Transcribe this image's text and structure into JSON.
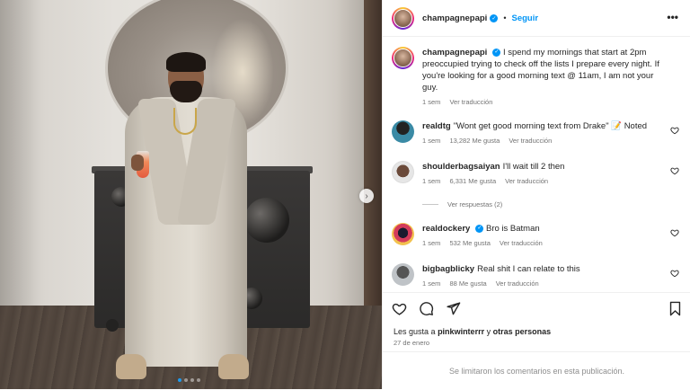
{
  "media": {
    "carousel_dots": 4,
    "active_dot": 0
  },
  "header": {
    "username": "champagnepapi",
    "separator": "•",
    "follow_label": "Seguir",
    "more_label": "•••"
  },
  "caption": {
    "username": "champagnepapi",
    "text": "I spend my mornings that start at 2pm preoccupied trying to check off the lists I prepare every night. If you're looking for a good morning text @ 11am, I am not your guy.",
    "time": "1 sem",
    "translate": "Ver traducción"
  },
  "comments": [
    {
      "username": "realdtg",
      "verified": false,
      "text": "\"Wont get good morning text from Drake\" 📝 Noted",
      "time": "1 sem",
      "likes": "13,282 Me gusta",
      "translate": "Ver traducción"
    },
    {
      "username": "shoulderbagsaiyan",
      "verified": false,
      "text": "I'll wait till 2 then",
      "time": "1 sem",
      "likes": "6,331 Me gusta",
      "translate": "Ver traducción"
    },
    {
      "username": "realdockery",
      "verified": true,
      "text": "Bro is Batman",
      "time": "1 sem",
      "likes": "532 Me gusta",
      "translate": "Ver traducción"
    },
    {
      "username": "bigbagblicky",
      "verified": false,
      "text": "Real shit I can relate to this",
      "time": "1 sem",
      "likes": "88 Me gusta",
      "translate": "Ver traducción"
    }
  ],
  "replies_label": "Ver respuestas (2)",
  "likes_line": {
    "prefix": "Les gusta a",
    "user": "pinkwinterrr",
    "middle": "y",
    "others": "otras personas"
  },
  "date": "27 de enero",
  "comments_limited": "Se limitaron los comentarios en esta publicación."
}
